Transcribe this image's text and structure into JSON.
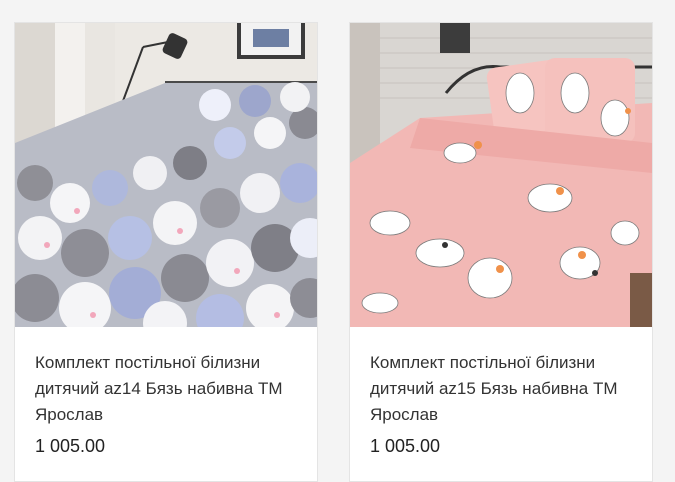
{
  "products": [
    {
      "title": "Комплект постільної білизни дитячий az14 Бязь набивна ТМ Ярослав",
      "price": "1 005.00",
      "image_icon": "bedding-bears-image"
    },
    {
      "title": "Комплект постільної білизни дитячий az15 Бязь набивна ТМ Ярослав",
      "price": "1 005.00",
      "image_icon": "bedding-cats-image"
    }
  ],
  "colors": {
    "page_background": "#f4f4f4",
    "card_background": "#ffffff",
    "title_text": "#333333",
    "price_text": "#222222"
  }
}
